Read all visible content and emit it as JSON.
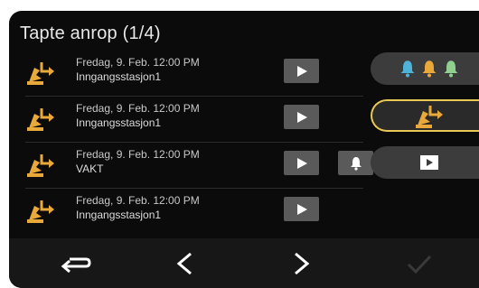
{
  "screen": {
    "title": "Tapte anrop (1/4)"
  },
  "calls": [
    {
      "date": "Fredag, 9. Feb. 12:00 PM",
      "caller": "Inngangsstasjon1",
      "has_bell": false
    },
    {
      "date": "Fredag, 9. Feb. 12:00 PM",
      "caller": "Inngangsstasjon1",
      "has_bell": false
    },
    {
      "date": "Fredag, 9. Feb. 12:00 PM",
      "caller": "VAKT",
      "has_bell": true
    },
    {
      "date": "Fredag, 9. Feb. 12:00 PM",
      "caller": "Inngangsstasjon1",
      "has_bell": false
    }
  ],
  "side_buttons": [
    {
      "name": "alarm-bells",
      "icons": [
        "bell-blue-icon",
        "bell-orange-icon",
        "bell-green-icon"
      ]
    },
    {
      "name": "missed-calls",
      "icons": [
        "missed-call-icon"
      ],
      "selected": true
    },
    {
      "name": "recordings",
      "icons": [
        "play-box-icon"
      ]
    }
  ],
  "nav": [
    "back-arrow-icon",
    "chevron-left-icon",
    "chevron-right-icon",
    "checkmark-icon"
  ],
  "colors": {
    "background": "#0b0b0b",
    "accent_orange": "#e8a83a",
    "selected_border": "#e9c955",
    "bell_blue": "#4fb3d8",
    "bell_orange": "#e8a83a",
    "bell_green": "#8fcf8f"
  }
}
